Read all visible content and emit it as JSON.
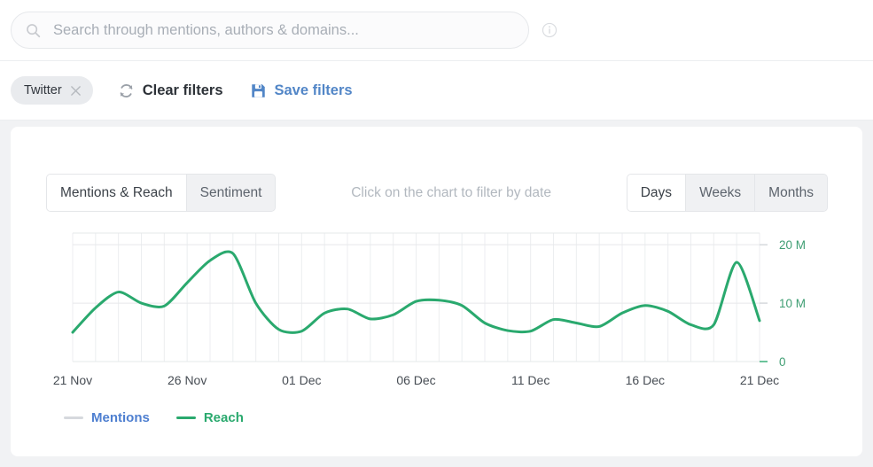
{
  "search": {
    "placeholder": "Search through mentions, authors & domains...",
    "value": "",
    "search_icon": "search-icon",
    "info_icon": "info-circle-icon"
  },
  "filters": {
    "chip_label": "Twitter",
    "chip_remove_icon": "close-icon",
    "clear_label": "Clear filters",
    "clear_icon": "refresh-icon",
    "save_label": "Save filters",
    "save_icon": "floppy-disk-icon",
    "save_color": "#5286c7"
  },
  "chart_header": {
    "metric_tabs": [
      {
        "label": "Mentions & Reach",
        "active": true
      },
      {
        "label": "Sentiment",
        "active": false
      }
    ],
    "hint": "Click on the chart to filter by date",
    "range_tabs": [
      {
        "label": "Days",
        "active": true
      },
      {
        "label": "Weeks",
        "active": false
      },
      {
        "label": "Months",
        "active": false
      }
    ]
  },
  "legend": [
    {
      "label": "Mentions",
      "color": "#4e7fd0",
      "swatch_color": "#d6d9dd",
      "active": false
    },
    {
      "label": "Reach",
      "color": "#2aa96e",
      "swatch_color": "#2aa96e",
      "active": true
    }
  ],
  "chart_data": {
    "type": "line",
    "title": "",
    "xlabel": "",
    "ylabel": "",
    "ylim": [
      0,
      22
    ],
    "yticks": [
      0,
      10,
      20
    ],
    "ytick_labels": [
      "0",
      "10 M",
      "20 M"
    ],
    "y_unit": "M",
    "grid": true,
    "grid_axis": "both",
    "legend_position": "bottom-left",
    "x": [
      "21 Nov",
      "22 Nov",
      "23 Nov",
      "24 Nov",
      "25 Nov",
      "26 Nov",
      "27 Nov",
      "28 Nov",
      "29 Nov",
      "30 Nov",
      "01 Dec",
      "02 Dec",
      "03 Dec",
      "04 Dec",
      "05 Dec",
      "06 Dec",
      "07 Dec",
      "08 Dec",
      "09 Dec",
      "10 Dec",
      "11 Dec",
      "12 Dec",
      "13 Dec",
      "14 Dec",
      "15 Dec",
      "16 Dec",
      "17 Dec",
      "18 Dec",
      "19 Dec",
      "20 Dec",
      "21 Dec"
    ],
    "xtick_labels": [
      "21 Nov",
      "26 Nov",
      "01 Dec",
      "06 Dec",
      "11 Dec",
      "16 Dec",
      "21 Dec"
    ],
    "xtick_indices": [
      0,
      5,
      10,
      15,
      20,
      25,
      30
    ],
    "series": [
      {
        "name": "Reach",
        "color": "#2aa96e",
        "visible": true,
        "values": [
          5.0,
          9.2,
          11.9,
          10.0,
          9.5,
          13.5,
          17.3,
          18.5,
          10.0,
          5.5,
          5.2,
          8.3,
          9.0,
          7.3,
          8.0,
          10.3,
          10.5,
          9.6,
          6.6,
          5.3,
          5.2,
          7.2,
          6.6,
          6.0,
          8.3,
          9.6,
          8.6,
          6.3,
          6.3,
          17.0,
          7.0
        ]
      },
      {
        "name": "Mentions",
        "color": "#4e7fd0",
        "visible": false,
        "values": []
      }
    ]
  }
}
